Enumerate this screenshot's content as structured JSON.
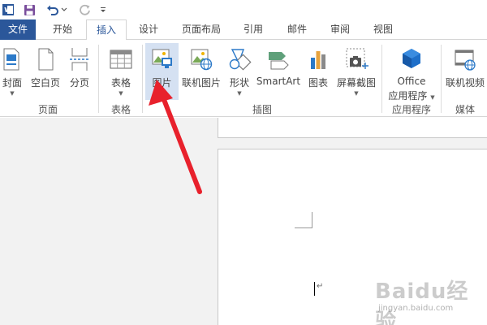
{
  "quick_access": {
    "app_icon": "word-icon",
    "save_icon": "save-icon",
    "undo_icon": "undo-icon",
    "redo_icon": "redo-icon",
    "customize_icon": "customize-icon"
  },
  "tabs": [
    {
      "label": "文件"
    },
    {
      "label": "开始"
    },
    {
      "label": "插入"
    },
    {
      "label": "设计"
    },
    {
      "label": "页面布局"
    },
    {
      "label": "引用"
    },
    {
      "label": "邮件"
    },
    {
      "label": "审阅"
    },
    {
      "label": "视图"
    }
  ],
  "active_tab": "插入",
  "ribbon": {
    "pages": {
      "name": "页面",
      "cover": {
        "label": "封面",
        "icon": "cover-page-icon"
      },
      "blank": {
        "label": "空白页",
        "icon": "blank-page-icon"
      },
      "break": {
        "label": "分页",
        "icon": "page-break-icon"
      }
    },
    "tables": {
      "name": "表格",
      "table": {
        "label": "表格",
        "icon": "table-icon"
      }
    },
    "illustrations": {
      "name": "插图",
      "picture": {
        "label": "图片",
        "icon": "picture-icon"
      },
      "online_picture": {
        "label": "联机图片",
        "icon": "online-picture-icon"
      },
      "shapes": {
        "label": "形状",
        "icon": "shapes-icon"
      },
      "smartart": {
        "label": "SmartArt",
        "icon": "smartart-icon"
      },
      "chart": {
        "label": "图表",
        "icon": "chart-icon"
      },
      "screenshot": {
        "label": "屏幕截图",
        "icon": "screenshot-icon"
      }
    },
    "apps": {
      "name": "应用程序",
      "office_apps": {
        "label_line1": "Office",
        "label_line2": "应用程序",
        "icon": "office-apps-icon"
      }
    },
    "media": {
      "name": "媒体",
      "online_video": {
        "label": "联机视频",
        "icon": "online-video-icon"
      }
    }
  },
  "watermark": {
    "text": "Baidu经验",
    "sub": "jingyan.baidu.com"
  },
  "colors": {
    "file_tab": "#2b579a",
    "selected_button": "#d5e1f2",
    "annotation_arrow": "#e8212c"
  }
}
